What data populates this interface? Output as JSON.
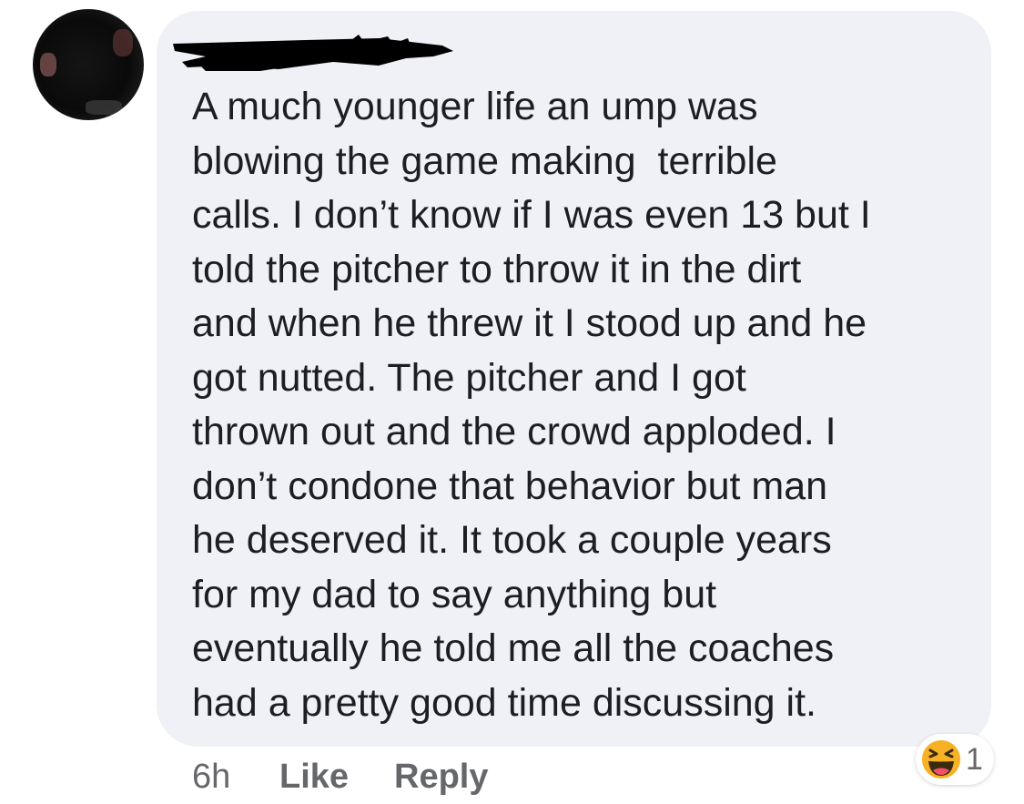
{
  "comment": {
    "text_lines": [
      "A much younger life an ump was",
      "blowing the game making  terrible",
      "calls. I don’t know if I was even 13 but I",
      "told the pitcher to throw it in the dirt",
      "and when he threw it I stood up and he",
      "got nutted. The pitcher and I got",
      "thrown out and the crowd apploded. I",
      "don’t condone that behavior but man",
      "he deserved it. It took a couple years",
      "for my dad to say anything but",
      "eventually he told me all the coaches",
      "had a pretty good time discussing it."
    ],
    "time": "6h",
    "like_label": "Like",
    "reply_label": "Reply"
  },
  "reactions": {
    "icon": "haha-emoji-icon",
    "count": "1"
  },
  "colors": {
    "bubble_background": "#eff1f6",
    "text": "#1c1e21",
    "meta_text": "#65676b",
    "haha_face": "#f7b125"
  }
}
